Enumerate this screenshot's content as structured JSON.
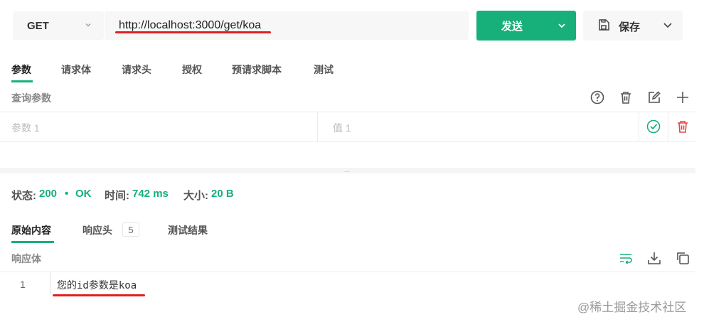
{
  "request": {
    "method": "GET",
    "url": "http://localhost:3000/get/koa",
    "send_label": "发送",
    "save_label": "保存"
  },
  "request_tabs": [
    "参数",
    "请求体",
    "请求头",
    "授权",
    "预请求脚本",
    "测试"
  ],
  "query_params": {
    "label": "查询参数",
    "key_placeholder": "参数 1",
    "value_placeholder": "值 1"
  },
  "status": {
    "status_label": "状态:",
    "status_code": "200",
    "dot": "•",
    "status_text": "OK",
    "time_label": "时间:",
    "time_value": "742 ms",
    "size_label": "大小:",
    "size_value": "20 B"
  },
  "response_tabs": {
    "raw": "原始内容",
    "headers": "响应头",
    "headers_count": "5",
    "tests": "测试结果"
  },
  "response_body": {
    "label": "响应体",
    "line_number": "1",
    "content": "您的id参数是koa"
  },
  "watermark": "@稀土掘金技术社区",
  "colors": {
    "accent": "#17b07a",
    "danger": "#e04848",
    "annotation": "#e02020"
  },
  "icons": {
    "help": "question-circle-icon",
    "delete_all": "trash-icon",
    "bulk_edit": "edit-icon",
    "add": "plus-icon",
    "check": "check-circle-icon",
    "delete_row": "trash-icon",
    "wrap": "wrap-lines-icon",
    "download": "download-icon",
    "copy": "copy-icon",
    "save": "save-icon"
  }
}
